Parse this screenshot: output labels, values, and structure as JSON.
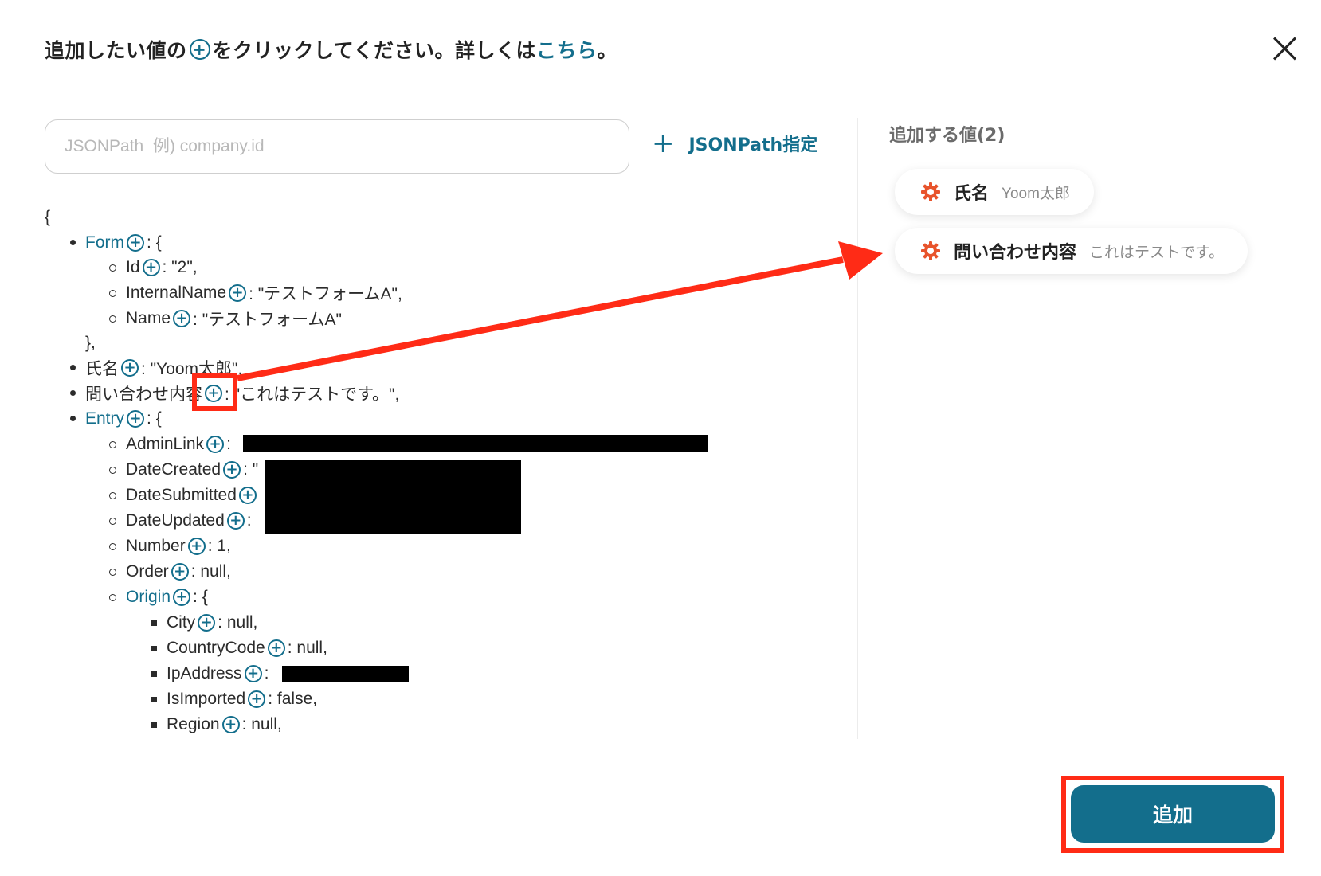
{
  "header": {
    "text_before": "追加したい値の",
    "text_after": "をクリックしてください。詳しくは",
    "link": "こちら",
    "text_end": "。"
  },
  "jsonpath": {
    "placeholder": "JSONPath  例) company.id",
    "button_label": "JSONPath指定"
  },
  "tree": {
    "open_brace": "{",
    "form_key": "Form",
    "form_tail": ": {",
    "id_key": "Id",
    "id_value": ": \"2\",",
    "internalname_key": "InternalName",
    "internalname_value": ": \"テストフォームA\",",
    "name_key": "Name",
    "name_value": ": \"テストフォームA\"",
    "form_close": "},",
    "shimei_key": "氏名",
    "shimei_value": ": \"Yoom太郎\",",
    "toiawase_key": "問い合わせ内容",
    "toiawase_value": ": \"これはテストです。\",",
    "entry_key": "Entry",
    "entry_tail": ": {",
    "adminlink_key": "AdminLink",
    "adminlink_value": ":",
    "datecreated_key": "DateCreated",
    "datecreated_value": ": \"",
    "datesubmitted_key": "DateSubmitted",
    "dateupdated_key": "DateUpdated",
    "dateupdated_value": ":",
    "number_key": "Number",
    "number_value": ": 1,",
    "order_key": "Order",
    "order_value": ": null,",
    "origin_key": "Origin",
    "origin_tail": ": {",
    "city_key": "City",
    "city_value": ": null,",
    "countrycode_key": "CountryCode",
    "countrycode_value": ": null,",
    "ipaddress_key": "IpAddress",
    "ipaddress_value": ":",
    "isimported_key": "IsImported",
    "isimported_value": ": false,",
    "region_key": "Region",
    "region_value": ": null,"
  },
  "right_panel": {
    "title": "追加する値(2)",
    "chips": [
      {
        "name": "氏名",
        "value": "Yoom太郎"
      },
      {
        "name": "問い合わせ内容",
        "value": "これはテストです。"
      }
    ]
  },
  "add_button": "追加",
  "colors": {
    "accent": "#136e8c",
    "highlight": "#ff2b16",
    "gear": "#e8542c"
  },
  "icons": {
    "plus_circle": "plus-circle-icon",
    "close": "close-icon",
    "gear": "gear-icon",
    "plus": "plus-icon"
  }
}
